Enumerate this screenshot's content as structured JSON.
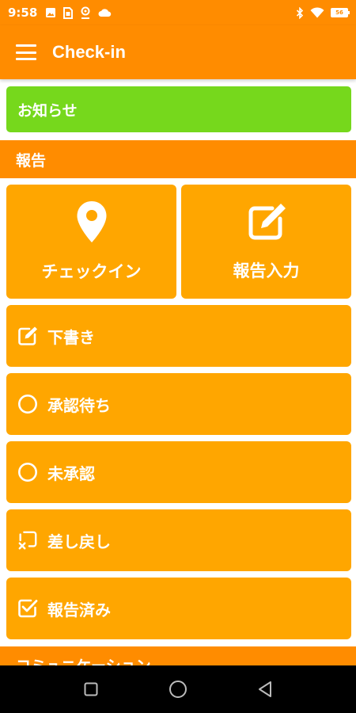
{
  "status_bar": {
    "time": "9:58",
    "battery": "56",
    "icons": [
      "image-icon",
      "sim-icon",
      "location-icon",
      "cloud-icon",
      "bluetooth-icon",
      "wifi-icon",
      "battery-icon"
    ]
  },
  "app_bar": {
    "title": "Check-in",
    "menu_icon": "hamburger-menu-icon"
  },
  "notice": {
    "label": "お知らせ"
  },
  "report_section": {
    "header": "報告",
    "checkin_label": "チェックイン",
    "report_input_label": "報告入力",
    "items": [
      {
        "label": "下書き",
        "icon": "edit-icon"
      },
      {
        "label": "承認待ち",
        "icon": "circle-icon"
      },
      {
        "label": "未承認",
        "icon": "circle-icon"
      },
      {
        "label": "差し戻し",
        "icon": "returned-icon"
      },
      {
        "label": "報告済み",
        "icon": "checked-box-icon"
      }
    ]
  },
  "communication_section": {
    "header": "コミュニケーション"
  },
  "colors": {
    "primary": "#ff8c00",
    "tile": "#ffa600",
    "notice": "#76d81c",
    "nav_bar": "#000000"
  },
  "nav_bar": {
    "icons": [
      "recent-apps-icon",
      "home-icon",
      "back-icon"
    ]
  }
}
